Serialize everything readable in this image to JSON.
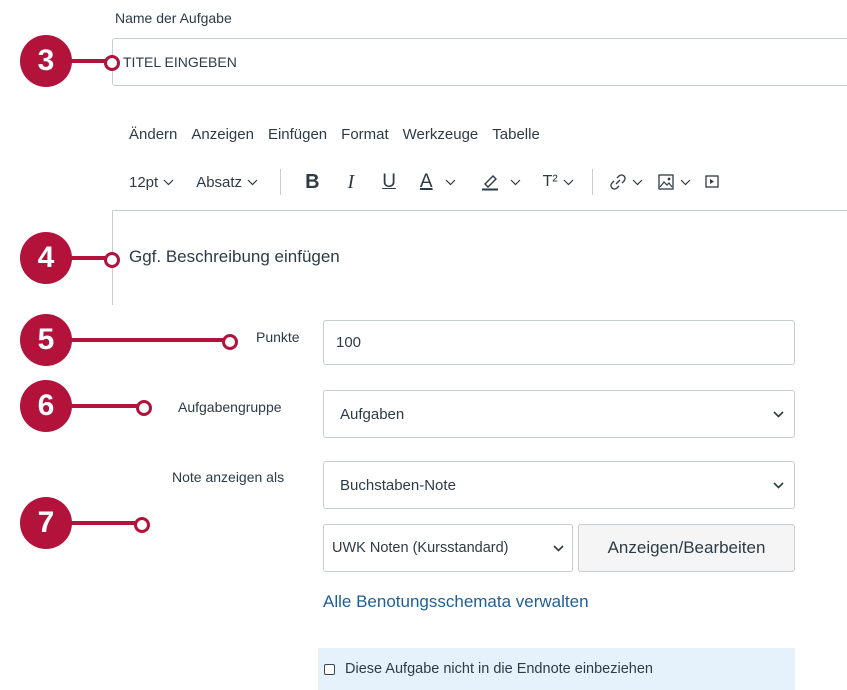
{
  "task_name": {
    "label": "Name der Aufgabe",
    "value": "TITEL EINGEBEN"
  },
  "editor": {
    "menu": [
      "Ändern",
      "Anzeigen",
      "Einfügen",
      "Format",
      "Werkzeuge",
      "Tabelle"
    ],
    "font_size": "12pt",
    "paragraph": "Absatz",
    "bold": "B",
    "italic": "I",
    "underline": "U",
    "text_color": "A",
    "superscript": "T²",
    "content": "Ggf. Beschreibung einfügen"
  },
  "points": {
    "label": "Punkte",
    "value": "100"
  },
  "group": {
    "label": "Aufgabengruppe",
    "value": "Aufgaben"
  },
  "grade_display": {
    "label": "Note anzeigen als",
    "value": "Buchstaben-Note",
    "scheme": "UWK Noten (Kursstandard)",
    "view_edit_button": "Anzeigen/Bearbeiten",
    "manage_link": "Alle Benotungsschemata verwalten"
  },
  "exclude_final": {
    "label": "Diese Aufgabe nicht in die Endnote einbeziehen",
    "checked": false
  },
  "callouts": [
    "3",
    "4",
    "5",
    "6",
    "7"
  ],
  "colors": {
    "accent": "#b3123b",
    "link": "#2b7abc",
    "border": "#c7cdd1",
    "checkbox_bg": "#e6f2fb"
  }
}
